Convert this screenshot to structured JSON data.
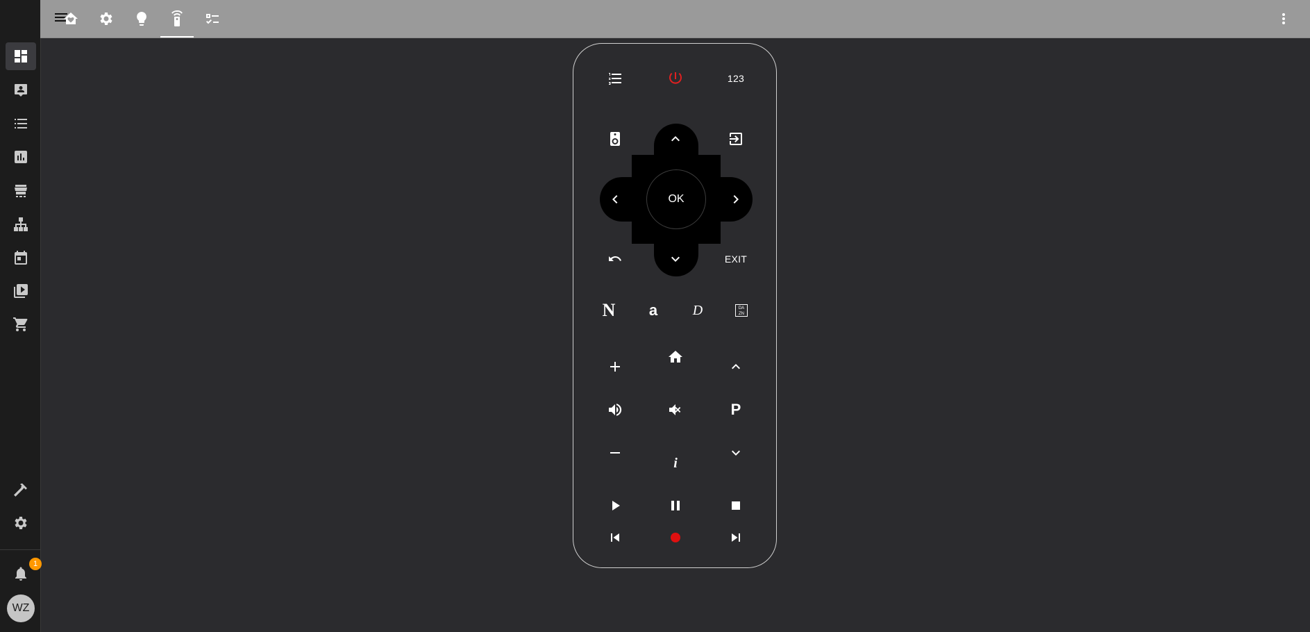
{
  "sidebar": {
    "items": [
      {
        "name": "sidebar-item-overview",
        "icon": "dashboard-icon"
      },
      {
        "name": "sidebar-item-energy",
        "icon": "account-box-icon"
      },
      {
        "name": "sidebar-item-logbook",
        "icon": "format-list-icon"
      },
      {
        "name": "sidebar-item-history",
        "icon": "chart-box-icon"
      },
      {
        "name": "sidebar-item-hacs",
        "icon": "hacs-store-icon"
      },
      {
        "name": "sidebar-item-map",
        "icon": "sitemap-icon"
      },
      {
        "name": "sidebar-item-calendar",
        "icon": "calendar-icon"
      },
      {
        "name": "sidebar-item-media",
        "icon": "play-box-multiple-icon"
      },
      {
        "name": "sidebar-item-shopping",
        "icon": "cart-icon"
      }
    ],
    "developer_tools_icon": "hammer-icon",
    "settings_icon": "gear-icon",
    "notifications_icon": "bell-icon",
    "notification_count": "1",
    "user_initials": "WZ"
  },
  "topbar": {
    "menu_icon": "menu-icon",
    "tabs": [
      {
        "name": "tab-home",
        "icon": "home-heart-icon"
      },
      {
        "name": "tab-settings",
        "icon": "gear-icon"
      },
      {
        "name": "tab-lights",
        "icon": "lightbulb-icon"
      },
      {
        "name": "tab-remote",
        "icon": "remote-icon",
        "active": true
      },
      {
        "name": "tab-checklist",
        "icon": "checklist-icon"
      }
    ],
    "overflow_icon": "dots-vertical-icon"
  },
  "remote": {
    "power_color": "#e02020",
    "record_color": "#e01010",
    "digits_label": "123",
    "ok_label": "OK",
    "exit_label": "EXIT",
    "netflix_label": "N",
    "amazon_label": "a",
    "disney_label": "D",
    "dazn_label": "DA ZN",
    "channel_label": "P",
    "info_label": "i"
  }
}
